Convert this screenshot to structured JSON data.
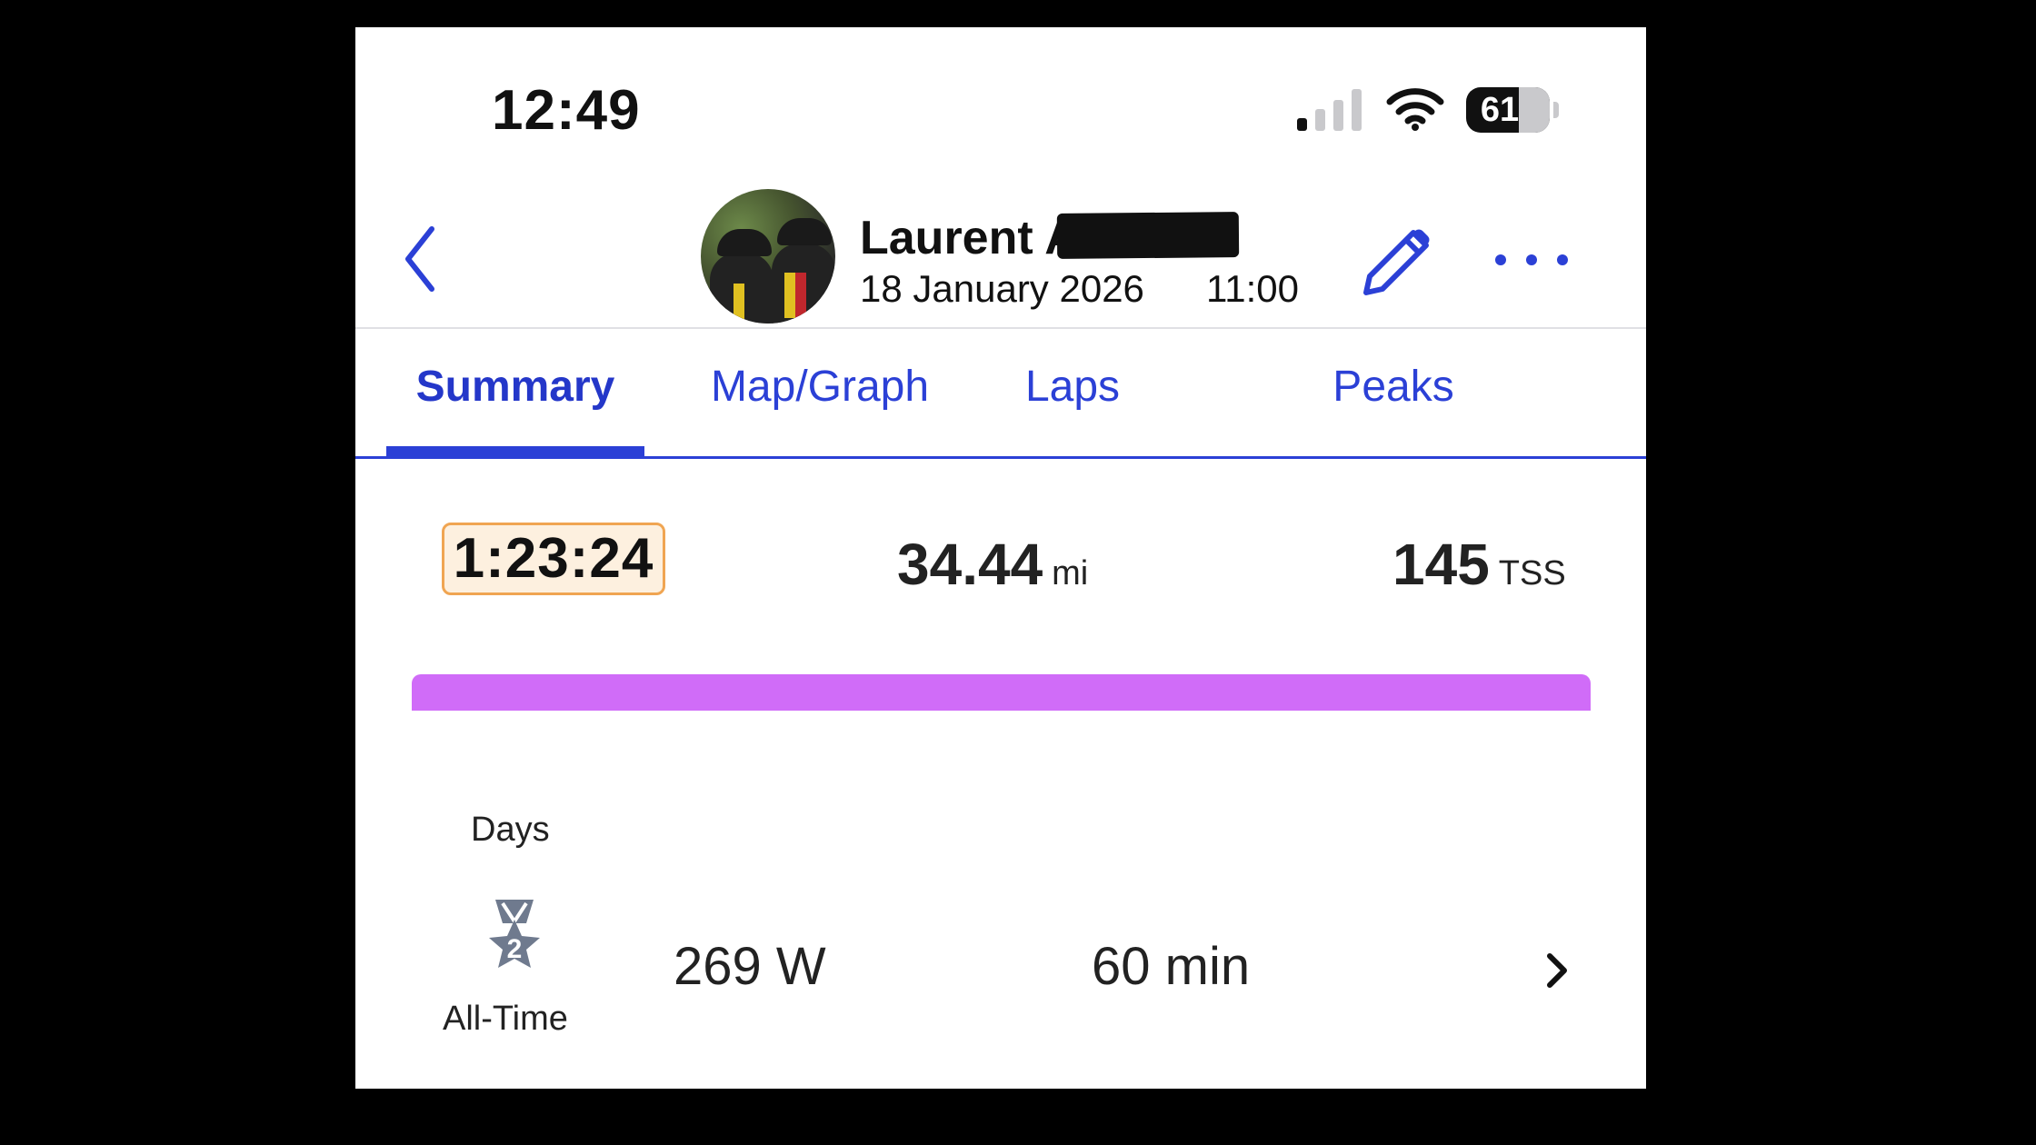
{
  "status_bar": {
    "time": "12:49",
    "battery_percent": "61",
    "cellular_bars_active": 1,
    "cellular_bars_total": 4
  },
  "header": {
    "athlete_name": "Laurent A",
    "date": "18 January 2026",
    "time": "11:00"
  },
  "tabs": [
    {
      "label": "Summary",
      "active": true
    },
    {
      "label": "Map/Graph",
      "active": false
    },
    {
      "label": "Laps",
      "active": false
    },
    {
      "label": "Peaks",
      "active": false
    }
  ],
  "metrics": {
    "duration": "1:23:24",
    "distance": {
      "value": "34.44",
      "unit": "mi"
    },
    "tss": {
      "value": "145",
      "unit": "TSS"
    }
  },
  "intensity_bar_color": "#d06cf8",
  "peaks": {
    "section_label": "Days",
    "row": {
      "medal_rank": "2",
      "medal_label": "All-Time",
      "value": "269 W",
      "duration": "60 min"
    }
  },
  "colors": {
    "accent": "#2b40d6",
    "duration_chip_border": "#f0a552",
    "duration_chip_bg": "#fdf0df",
    "medal": "#6f7a8e"
  }
}
